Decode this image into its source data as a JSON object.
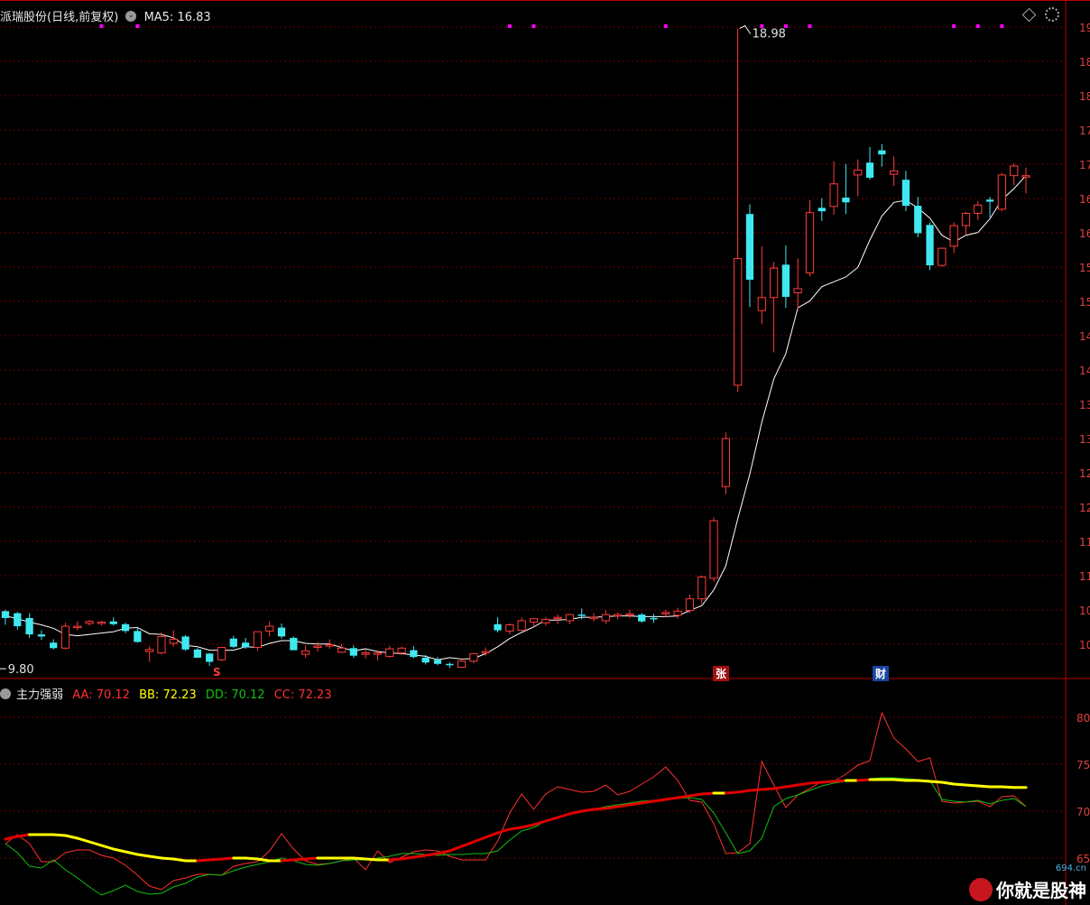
{
  "header": {
    "title": "派瑞股份(日线,前复权)",
    "ma_label": "MA5: 16.83"
  },
  "price_axis": {
    "labels": [
      "19",
      "18",
      "18",
      "17",
      "17",
      "16",
      "16",
      "15",
      "15",
      "14",
      "14",
      "13",
      "13",
      "12",
      "12",
      "11",
      "11",
      "10",
      "10"
    ]
  },
  "annotations": {
    "high_label": "18.98",
    "low_label": "9.80",
    "marker_s": "S",
    "marker_zhang": "张",
    "marker_cai": "财"
  },
  "indicator": {
    "name": "主力强弱",
    "aa_label": "AA: 70.12",
    "bb_label": "BB: 72.23",
    "dd_label": "DD: 70.12",
    "cc_label": "CC: 72.23",
    "axis_labels": [
      "80",
      "75",
      "70",
      "65"
    ]
  },
  "watermark": {
    "text": "你就是股神",
    "site": "694.cn"
  },
  "colors": {
    "up": "#ff3c3c",
    "down": "#3fe8f0",
    "ma": "#ffffff",
    "grid": "#6e0000",
    "axis": "#b80000",
    "aa": "#ff3030",
    "bb": "#ffff00",
    "dd": "#10c010",
    "cc": "#e00000",
    "signal_dot": "#ff00ff"
  },
  "chart_data": [
    {
      "type": "candlestick",
      "title": "派瑞股份(日线,前复权)",
      "ma5_last": 16.83,
      "high": 18.98,
      "low": 9.8,
      "candles": [
        [
          10.47,
          10.49,
          10.27,
          10.37
        ],
        [
          10.44,
          10.46,
          10.2,
          10.25
        ],
        [
          10.37,
          10.44,
          10.08,
          10.13
        ],
        [
          10.13,
          10.19,
          10.05,
          10.1
        ],
        [
          10.01,
          10.06,
          9.91,
          9.93
        ],
        [
          9.93,
          10.3,
          9.91,
          10.25
        ],
        [
          10.25,
          10.32,
          10.19,
          10.25
        ],
        [
          10.29,
          10.34,
          10.26,
          10.32
        ],
        [
          10.3,
          10.33,
          10.26,
          10.31
        ],
        [
          10.32,
          10.38,
          10.26,
          10.28
        ],
        [
          10.28,
          10.3,
          10.15,
          10.18
        ],
        [
          10.18,
          10.24,
          10.01,
          10.02
        ],
        [
          9.88,
          9.96,
          9.73,
          9.91
        ],
        [
          9.86,
          10.16,
          9.84,
          10.1
        ],
        [
          10.0,
          10.19,
          9.95,
          10.06
        ],
        [
          10.1,
          10.12,
          9.89,
          9.91
        ],
        [
          9.91,
          9.93,
          9.79,
          9.79
        ],
        [
          9.85,
          9.86,
          9.67,
          9.73
        ],
        [
          9.76,
          9.94,
          9.74,
          9.94
        ],
        [
          10.07,
          10.11,
          9.93,
          9.95
        ],
        [
          10.01,
          10.08,
          9.92,
          9.94
        ],
        [
          9.94,
          10.17,
          9.89,
          10.17
        ],
        [
          10.18,
          10.32,
          10.1,
          10.25
        ],
        [
          10.23,
          10.29,
          10.07,
          10.1
        ],
        [
          10.08,
          10.1,
          9.9,
          9.9
        ],
        [
          9.84,
          9.97,
          9.79,
          9.89
        ],
        [
          9.95,
          10.02,
          9.88,
          9.96
        ],
        [
          9.97,
          10.06,
          9.92,
          9.98
        ],
        [
          9.87,
          9.99,
          9.86,
          9.93
        ],
        [
          9.93,
          9.97,
          9.79,
          9.82
        ],
        [
          9.84,
          9.91,
          9.78,
          9.86
        ],
        [
          9.85,
          9.9,
          9.75,
          9.86
        ],
        [
          9.81,
          9.96,
          9.79,
          9.92
        ],
        [
          9.86,
          9.95,
          9.83,
          9.93
        ],
        [
          9.9,
          9.96,
          9.78,
          9.8
        ],
        [
          9.79,
          9.83,
          9.69,
          9.72
        ],
        [
          9.76,
          9.8,
          9.68,
          9.7
        ],
        [
          9.7,
          9.72,
          9.64,
          9.68
        ],
        [
          9.65,
          9.78,
          9.64,
          9.74
        ],
        [
          9.74,
          9.86,
          9.71,
          9.85
        ],
        [
          9.88,
          9.94,
          9.82,
          9.88
        ],
        [
          10.28,
          10.38,
          10.16,
          10.19
        ],
        [
          10.18,
          10.29,
          10.13,
          10.27
        ],
        [
          10.19,
          10.38,
          10.18,
          10.33
        ],
        [
          10.31,
          10.36,
          10.24,
          10.36
        ],
        [
          10.3,
          10.38,
          10.26,
          10.35
        ],
        [
          10.36,
          10.42,
          10.28,
          10.38
        ],
        [
          10.33,
          10.43,
          10.28,
          10.42
        ],
        [
          10.42,
          10.51,
          10.35,
          10.4
        ],
        [
          10.38,
          10.44,
          10.32,
          10.38
        ],
        [
          10.33,
          10.48,
          10.28,
          10.42
        ],
        [
          10.42,
          10.45,
          10.35,
          10.42
        ],
        [
          10.42,
          10.49,
          10.37,
          10.43
        ],
        [
          10.42,
          10.44,
          10.3,
          10.32
        ],
        [
          10.37,
          10.43,
          10.3,
          10.36
        ],
        [
          10.44,
          10.49,
          10.38,
          10.45
        ],
        [
          10.41,
          10.52,
          10.36,
          10.47
        ],
        [
          10.48,
          10.71,
          10.44,
          10.65
        ],
        [
          10.65,
          10.99,
          10.58,
          10.97
        ],
        [
          10.95,
          11.84,
          10.9,
          11.79
        ],
        [
          12.29,
          13.08,
          12.18,
          12.99
        ],
        [
          13.77,
          18.98,
          13.67,
          15.62
        ],
        [
          16.27,
          16.41,
          14.91,
          15.31
        ],
        [
          14.86,
          15.8,
          14.66,
          15.05
        ],
        [
          15.05,
          15.57,
          14.25,
          15.48
        ],
        [
          15.53,
          15.81,
          14.9,
          15.06
        ],
        [
          15.12,
          15.62,
          14.88,
          15.18
        ],
        [
          15.41,
          16.47,
          15.36,
          16.29
        ],
        [
          16.36,
          16.5,
          16.17,
          16.31
        ],
        [
          16.38,
          17.04,
          16.26,
          16.71
        ],
        [
          16.51,
          17.0,
          16.27,
          16.44
        ],
        [
          16.84,
          17.07,
          16.53,
          16.91
        ],
        [
          17.02,
          17.25,
          16.77,
          16.8
        ],
        [
          17.2,
          17.29,
          16.96,
          17.14
        ],
        [
          16.85,
          17.11,
          16.68,
          16.9
        ],
        [
          16.77,
          16.9,
          16.31,
          16.39
        ],
        [
          16.39,
          16.52,
          15.93,
          15.99
        ],
        [
          16.11,
          16.15,
          15.45,
          15.52
        ],
        [
          15.52,
          15.78,
          15.5,
          15.77
        ],
        [
          15.8,
          16.15,
          15.7,
          16.1
        ],
        [
          16.1,
          16.3,
          15.97,
          16.28
        ],
        [
          16.28,
          16.46,
          16.18,
          16.4
        ],
        [
          16.48,
          16.52,
          16.22,
          16.45
        ],
        [
          16.34,
          16.87,
          16.31,
          16.84
        ],
        [
          16.83,
          17.01,
          16.69,
          16.97
        ],
        [
          16.81,
          16.95,
          16.57,
          16.83
        ]
      ],
      "ma5": [
        10.4,
        10.36,
        10.31,
        10.27,
        10.22,
        10.13,
        10.11,
        10.13,
        10.15,
        10.17,
        10.22,
        10.23,
        10.14,
        10.13,
        10.08,
        9.97,
        9.95,
        9.9,
        9.9,
        9.9,
        9.95,
        9.94,
        10.0,
        10.04,
        10.04,
        10.0,
        9.99,
        9.99,
        9.94,
        9.89,
        9.92,
        9.88,
        9.86,
        9.85,
        9.83,
        9.81,
        9.76,
        9.79,
        9.77,
        9.78,
        9.85,
        9.95,
        10.07,
        10.16,
        10.24,
        10.34,
        10.34,
        10.35,
        10.38,
        10.38,
        10.39,
        10.4,
        10.4,
        10.39,
        10.39,
        10.39,
        10.4,
        10.48,
        10.55,
        10.78,
        11.13,
        11.82,
        12.47,
        13.23,
        13.86,
        14.23,
        14.9,
        15.0,
        15.21,
        15.28,
        15.35,
        15.49,
        15.89,
        16.24,
        16.44,
        16.47,
        16.36,
        16.21,
        15.96,
        15.86,
        15.96,
        16.0,
        16.2,
        16.48,
        16.64,
        16.83
      ]
    },
    {
      "type": "line",
      "title": "主力强弱",
      "ylim": [
        60,
        80
      ],
      "series": [
        {
          "name": "AA",
          "values": [
            66,
            67,
            66,
            64,
            64,
            65,
            65.3,
            65.3,
            64.7,
            64.4,
            63.6,
            62.5,
            61.3,
            60.9,
            61.9,
            62.2,
            62.6,
            62.6,
            62.5,
            63.5,
            63.8,
            64.0,
            65.2,
            67.1,
            65.4,
            64.1,
            63.7,
            63.8,
            64.1,
            64.4,
            63.1,
            65.2,
            63.9,
            64.5,
            65.1,
            65.3,
            65.2,
            64.6,
            64.2,
            64.2,
            64.2,
            66.3,
            69.4,
            71.5,
            69.8,
            71.5,
            72.3,
            72.0,
            71.7,
            71.8,
            72.5,
            71.4,
            71.8,
            72.6,
            73.4,
            74.5,
            73.0,
            70.8,
            70.6,
            68.2,
            64.9,
            65.0,
            66.0,
            75.1,
            72.5,
            70.0,
            71.4,
            72.1,
            72.9,
            72.9,
            73.7,
            74.7,
            75.2,
            80.5,
            77.7,
            76.5,
            75.1,
            75.5,
            70.7,
            70.5,
            70.6,
            70.7,
            70.1,
            71.2,
            71.3,
            70.12
          ]
        },
        {
          "name": "BB",
          "values": [
            66.5,
            66.8,
            67.0,
            67.0,
            67.0,
            66.9,
            66.6,
            66.2,
            65.8,
            65.4,
            65.1,
            64.8,
            64.6,
            64.4,
            64.3,
            64.1,
            64.1,
            64.2,
            64.3,
            64.4,
            64.4,
            64.3,
            64.1,
            64.1,
            64.2,
            64.3,
            64.4,
            64.4,
            64.4,
            64.4,
            64.3,
            64.2,
            64.2,
            64.3,
            64.5,
            64.7,
            64.9,
            65.2,
            65.7,
            66.2,
            66.7,
            67.2,
            67.6,
            67.8,
            68.1,
            68.5,
            68.9,
            69.3,
            69.6,
            69.8,
            69.9,
            70.1,
            70.3,
            70.5,
            70.7,
            70.9,
            71.1,
            71.3,
            71.5,
            71.6,
            71.6,
            71.7,
            71.9,
            72.0,
            72.1,
            72.3,
            72.5,
            72.7,
            72.8,
            72.9,
            73.0,
            73.0,
            73.1,
            73.1,
            73.1,
            73.0,
            73.0,
            72.9,
            72.8,
            72.6,
            72.5,
            72.4,
            72.3,
            72.3,
            72.23,
            72.23
          ]
        },
        {
          "name": "DD",
          "values": [
            66,
            65,
            63.5,
            63.3,
            64.2,
            63.1,
            62.2,
            61.2,
            60.3,
            60.8,
            61.4,
            60.7,
            60.4,
            60.5,
            61.2,
            61.6,
            62.3,
            62.6,
            62.5,
            63.0,
            63.4,
            63.7,
            64.0,
            64.4,
            64.1,
            63.7,
            63.6,
            63.8,
            64.1,
            64.2,
            64.2,
            64.4,
            64.6,
            64.9,
            64.9,
            64.8,
            64.7,
            64.8,
            64.8,
            64.9,
            64.9,
            65.2,
            66.4,
            67.4,
            67.8,
            68.5,
            68.9,
            69.3,
            69.6,
            69.8,
            70.1,
            70.3,
            70.5,
            70.7,
            70.8,
            70.9,
            71.0,
            71.1,
            70.9,
            69.4,
            67.2,
            64.9,
            65.2,
            66.6,
            70.1,
            71.0,
            71.4,
            71.9,
            72.4,
            72.7,
            72.9,
            73.0,
            73.2,
            73.3,
            73.3,
            73.2,
            73.1,
            73.0,
            70.9,
            70.7,
            70.6,
            70.8,
            70.4,
            70.8,
            71.0,
            70.12
          ]
        },
        {
          "name": "CC",
          "values": [
            66.5,
            66.8,
            67.0,
            67.0,
            67.0,
            66.9,
            66.6,
            66.2,
            65.8,
            65.4,
            65.1,
            64.8,
            64.6,
            64.4,
            64.3,
            64.1,
            64.1,
            64.2,
            64.3,
            64.4,
            64.4,
            64.3,
            64.1,
            64.1,
            64.2,
            64.3,
            64.4,
            64.4,
            64.4,
            64.4,
            64.3,
            64.2,
            64.2,
            64.3,
            64.5,
            64.7,
            64.9,
            65.2,
            65.7,
            66.2,
            66.7,
            67.2,
            67.6,
            67.8,
            68.1,
            68.5,
            68.9,
            69.3,
            69.6,
            69.8,
            69.9,
            70.1,
            70.3,
            70.5,
            70.7,
            70.9,
            71.1,
            71.3,
            71.5,
            71.6,
            71.6,
            71.7,
            71.9,
            72.0,
            72.1,
            72.3,
            72.5,
            72.7,
            72.8,
            72.9,
            73.0,
            73.0,
            73.1,
            73.1,
            73.1,
            73.0,
            73.0,
            72.9,
            72.8,
            72.6,
            72.5,
            72.4,
            72.3,
            72.3,
            72.23,
            72.23
          ]
        }
      ]
    }
  ]
}
